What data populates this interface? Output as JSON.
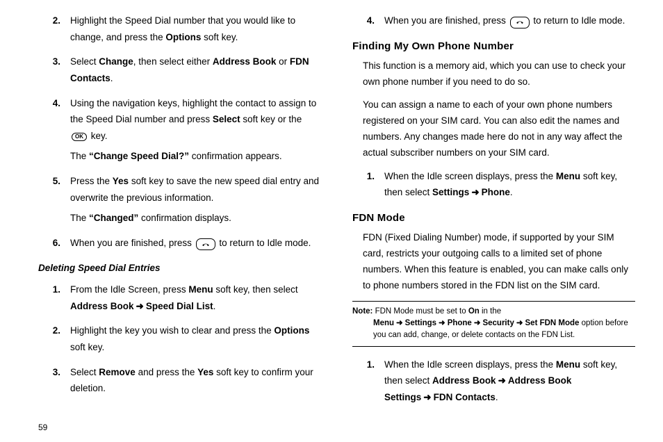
{
  "pageNumber": "59",
  "left": {
    "items": [
      {
        "num": "2.",
        "parts": [
          {
            "t": "Highlight the Speed Dial number that you would like to change, and press the "
          },
          {
            "t": "Options",
            "b": true
          },
          {
            "t": " soft key."
          }
        ]
      },
      {
        "num": "3.",
        "parts": [
          {
            "t": "Select "
          },
          {
            "t": "Change",
            "b": true
          },
          {
            "t": ", then select either "
          },
          {
            "t": "Address Book",
            "b": true
          },
          {
            "t": " or "
          },
          {
            "t": "FDN Contacts",
            "b": true
          },
          {
            "t": "."
          }
        ]
      },
      {
        "num": "4.",
        "parts": [
          {
            "t": "Using the navigation keys, highlight the contact to assign to the Speed Dial number and press "
          },
          {
            "t": "Select",
            "b": true
          },
          {
            "t": " soft key or the "
          },
          {
            "icon": "ok"
          },
          {
            "t": " key."
          }
        ],
        "sub": [
          {
            "t": "The "
          },
          {
            "t": "“Change Speed Dial?”",
            "b": true
          },
          {
            "t": " confirmation appears."
          }
        ]
      },
      {
        "num": "5.",
        "parts": [
          {
            "t": "Press the "
          },
          {
            "t": "Yes",
            "b": true
          },
          {
            "t": " soft key to save the new speed dial entry and overwrite the previous information."
          }
        ],
        "sub": [
          {
            "t": "The "
          },
          {
            "t": "“Changed”",
            "b": true
          },
          {
            "t": " confirmation displays."
          }
        ]
      },
      {
        "num": "6.",
        "parts": [
          {
            "t": "When you are finished, press "
          },
          {
            "icon": "end"
          },
          {
            "t": " to return to Idle mode."
          }
        ]
      }
    ],
    "subheading": "Deleting Speed Dial Entries",
    "items2": [
      {
        "num": "1.",
        "parts": [
          {
            "t": "From the Idle Screen, press "
          },
          {
            "t": "Menu",
            "b": true
          },
          {
            "t": " soft key, then select "
          },
          {
            "t": "Address Book",
            "b": true
          },
          {
            "arrow": true
          },
          {
            "t": "Speed Dial List",
            "b": true
          },
          {
            "t": "."
          }
        ]
      },
      {
        "num": "2.",
        "parts": [
          {
            "t": "Highlight the key you wish to clear and press the "
          },
          {
            "t": "Options",
            "b": true
          },
          {
            "t": " soft key."
          }
        ]
      },
      {
        "num": "3.",
        "parts": [
          {
            "t": "Select "
          },
          {
            "t": "Remove",
            "b": true
          },
          {
            "t": " and press the "
          },
          {
            "t": "Yes",
            "b": true
          },
          {
            "t": " soft key to confirm your deletion."
          }
        ]
      }
    ]
  },
  "right": {
    "topItem": {
      "num": "4.",
      "parts": [
        {
          "t": "When you are finished, press "
        },
        {
          "icon": "end"
        },
        {
          "t": " to return to Idle mode."
        }
      ]
    },
    "heading1": "Finding My Own Phone Number",
    "para1": "This function is a memory aid, which you can use to check your own phone number if you need to do so.",
    "para2": "You can assign a name to each of your own phone numbers registered on your SIM card. You can also edit the names and numbers. Any changes made here do not in any way affect the actual subscriber numbers on your SIM card.",
    "item1": {
      "num": "1.",
      "parts": [
        {
          "t": "When the Idle screen displays, press the "
        },
        {
          "t": "Menu",
          "b": true
        },
        {
          "t": " soft key, then select "
        },
        {
          "t": "Settings",
          "b": true
        },
        {
          "arrow": true
        },
        {
          "t": "Phone",
          "b": true
        },
        {
          "t": "."
        }
      ]
    },
    "heading2": "FDN Mode",
    "para3": "FDN (Fixed Dialing Number) mode, if supported by your SIM card, restricts your outgoing calls to a limited set of phone numbers. When this feature is enabled, you can make calls only to phone numbers stored in the FDN list on the SIM card.",
    "note": {
      "label": "Note:",
      "parts": [
        {
          "t": "FDN Mode must be set to "
        },
        {
          "t": "On",
          "b": true
        },
        {
          "t": " in the "
        },
        {
          "t": "Menu",
          "b": true
        },
        {
          "arrow": true
        },
        {
          "t": "Settings",
          "b": true
        },
        {
          "arrow": true
        },
        {
          "t": "Phone",
          "b": true
        },
        {
          "arrow": true
        },
        {
          "t": "Security",
          "b": true
        },
        {
          "arrow": true
        },
        {
          "t": "Set FDN Mode",
          "b": true
        },
        {
          "t": " option before you can add, change, or delete contacts on the FDN List."
        }
      ]
    },
    "item2": {
      "num": "1.",
      "parts": [
        {
          "t": "When the Idle screen displays, press the "
        },
        {
          "t": "Menu",
          "b": true
        },
        {
          "t": " soft key, then select "
        },
        {
          "t": "Address Book",
          "b": true
        },
        {
          "arrow": true
        },
        {
          "t": "Address Book Settings",
          "b": true
        },
        {
          "arrow": true
        },
        {
          "t": "FDN Contacts",
          "b": true
        },
        {
          "t": "."
        }
      ]
    }
  }
}
